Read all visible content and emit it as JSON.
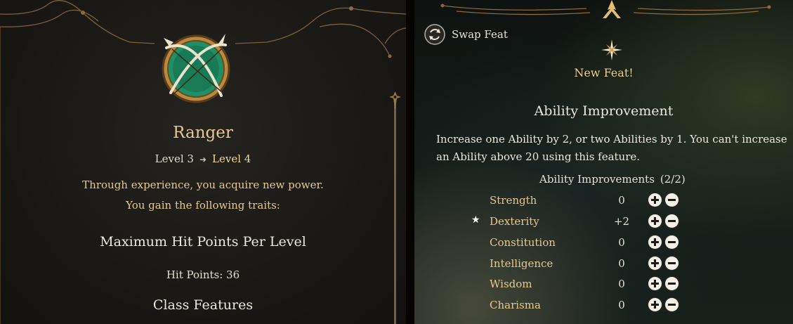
{
  "level_up_panel": {
    "class_icon": "crossed-bow-and-arrow-emblem-icon",
    "class_name": "Ranger",
    "level_from": "Level 3",
    "level_to": "Level 4",
    "description_line1": "Through experience, you acquire new power.",
    "description_line2": "You gain the following traits:",
    "hp_section_title": "Maximum Hit Points Per Level",
    "hit_points_text": "Hit Points: 36",
    "class_features_title": "Class Features"
  },
  "feat_panel": {
    "swap_feat_label": "Swap Feat",
    "swap_icon": "swap-arrows-icon",
    "new_feat_icon": "four-point-star-icon",
    "new_feat_label": "New Feat!",
    "feat_title": "Ability Improvement",
    "feat_description": "Increase one Ability by 2, or two Abilities by 1. You can't increase an Ability above 20 using this feature.",
    "improvements_label": "Ability Improvements",
    "improvements_count": "(2/2)",
    "abilities": [
      {
        "name": "Strength",
        "value": "0",
        "starred": false
      },
      {
        "name": "Dexterity",
        "value": "+2",
        "starred": true
      },
      {
        "name": "Constitution",
        "value": "0",
        "starred": false
      },
      {
        "name": "Intelligence",
        "value": "0",
        "starred": false
      },
      {
        "name": "Wisdom",
        "value": "0",
        "starred": false
      },
      {
        "name": "Charisma",
        "value": "0",
        "starred": false
      }
    ]
  },
  "colors": {
    "gold_text": "#e5c98f",
    "gold_ornament": "#8a6a3e",
    "white_text": "#ece8de",
    "emblem_green": "#1f8f66"
  }
}
